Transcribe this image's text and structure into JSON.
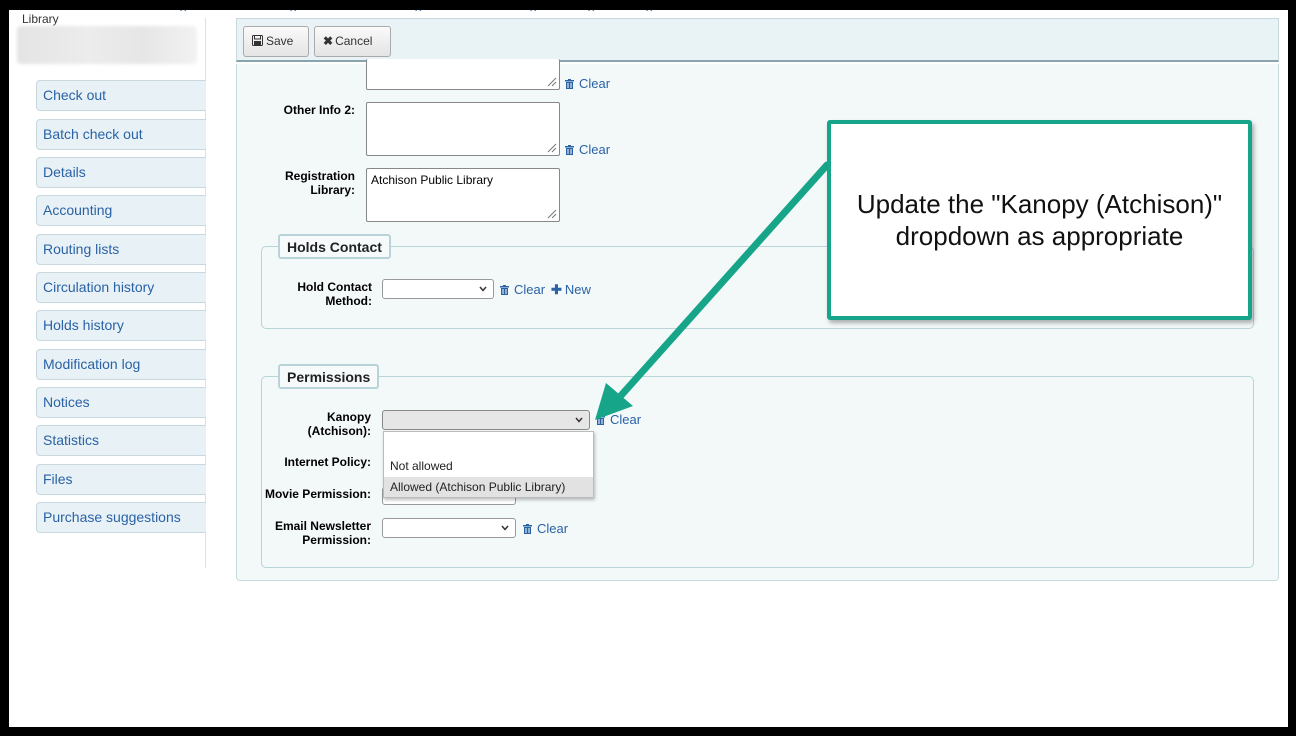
{
  "sidebar": {
    "library_label": "Library",
    "items": [
      {
        "label": "Check out"
      },
      {
        "label": "Batch check out"
      },
      {
        "label": "Details"
      },
      {
        "label": "Accounting"
      },
      {
        "label": "Routing lists"
      },
      {
        "label": "Circulation history"
      },
      {
        "label": "Holds history"
      },
      {
        "label": "Modification log"
      },
      {
        "label": "Notices"
      },
      {
        "label": "Statistics"
      },
      {
        "label": "Files"
      },
      {
        "label": "Purchase suggestions"
      }
    ]
  },
  "toolbar": {
    "save_label": "Save",
    "cancel_label": "Cancel"
  },
  "form": {
    "clear_label": "Clear",
    "new_label": "New",
    "other_info_2_label": "Other Info 2:",
    "registration_library_label": "Registration Library:",
    "registration_library_value": "Atchison Public Library",
    "holds_contact_legend": "Holds Contact",
    "hold_contact_method_label": "Hold Contact Method:",
    "permissions_legend": "Permissions",
    "kanopy_label": "Kanopy (Atchison):",
    "internet_policy_label": "Internet Policy:",
    "movie_permission_label": "Movie Permission:",
    "email_newsletter_label": "Email Newsletter Permission:",
    "kanopy_options": [
      "",
      "Not allowed",
      "Allowed (Atchison Public Library)"
    ],
    "kanopy_highlighted_option": "Allowed (Atchison Public Library)"
  },
  "annotation": {
    "text": "Update the \"Kanopy (Atchison)\" dropdown as appropriate",
    "accent_color": "#17a589"
  },
  "colors": {
    "link": "#2a62a6",
    "panel_bg": "#f3f8f9",
    "sidebar_bg": "#e8f1f5"
  }
}
